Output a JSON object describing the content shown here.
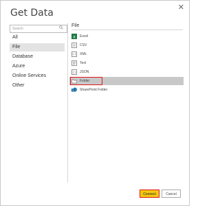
{
  "dialog": {
    "title": "Get Data",
    "close_glyph": "✕"
  },
  "search": {
    "placeholder": "Search"
  },
  "categories": [
    {
      "label": "All",
      "active": false
    },
    {
      "label": "File",
      "active": true
    },
    {
      "label": "Database",
      "active": false
    },
    {
      "label": "Azure",
      "active": false
    },
    {
      "label": "Online Services",
      "active": false
    },
    {
      "label": "Other",
      "active": false
    }
  ],
  "section": {
    "title": "File"
  },
  "items": [
    {
      "label": "Excel",
      "icon": "excel-icon",
      "selected": false
    },
    {
      "label": "CSV",
      "icon": "csv-icon",
      "selected": false
    },
    {
      "label": "XML",
      "icon": "xml-icon",
      "selected": false
    },
    {
      "label": "Text",
      "icon": "text-icon",
      "selected": false
    },
    {
      "label": "JSON",
      "icon": "json-icon",
      "selected": false
    },
    {
      "label": "Folder",
      "icon": "folder-icon",
      "selected": true
    },
    {
      "label": "SharePoint Folder",
      "icon": "sharepoint-icon",
      "selected": false
    }
  ],
  "buttons": {
    "connect": "Connect",
    "cancel": "Cancel"
  },
  "colors": {
    "connect_bg": "#f2c811",
    "highlight": "#e01818",
    "selected_bg": "#c8c8c8"
  }
}
